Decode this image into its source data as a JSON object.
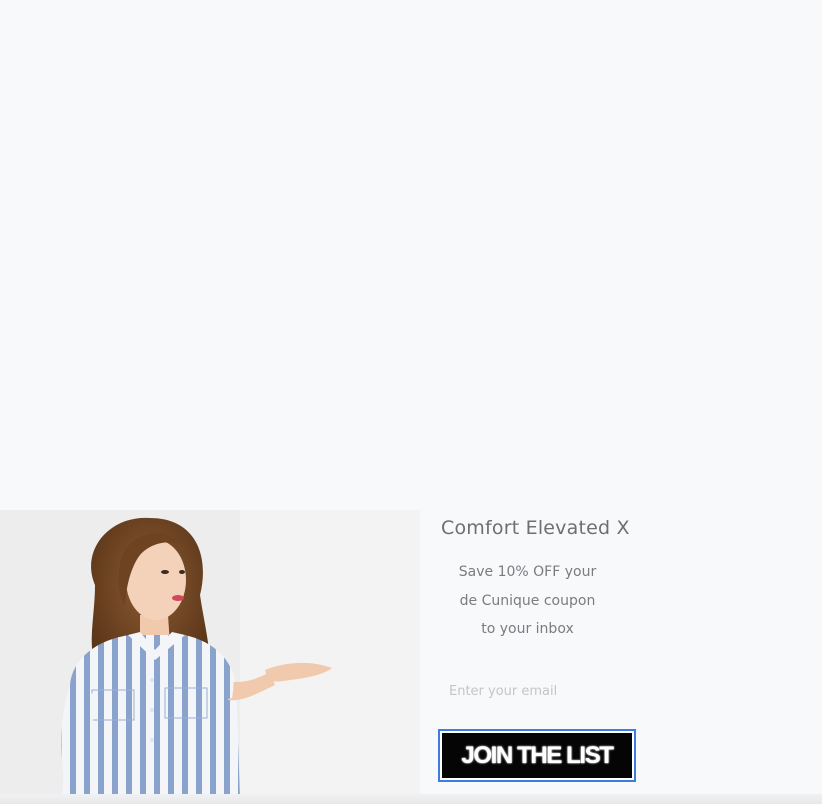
{
  "popup": {
    "title": "Comfort Elevated X",
    "subtitle": "Save 10% OFF your\nde Cunique coupon\nto your inbox",
    "email": {
      "placeholder": "Enter your email",
      "value": ""
    },
    "join_button_label": "JOIN THE LIST"
  },
  "colors": {
    "page_background": "#f8f9fb",
    "button_background": "#050505",
    "button_focus_ring": "#3f7be0",
    "shirt_stripe": "#8aa3cc"
  }
}
